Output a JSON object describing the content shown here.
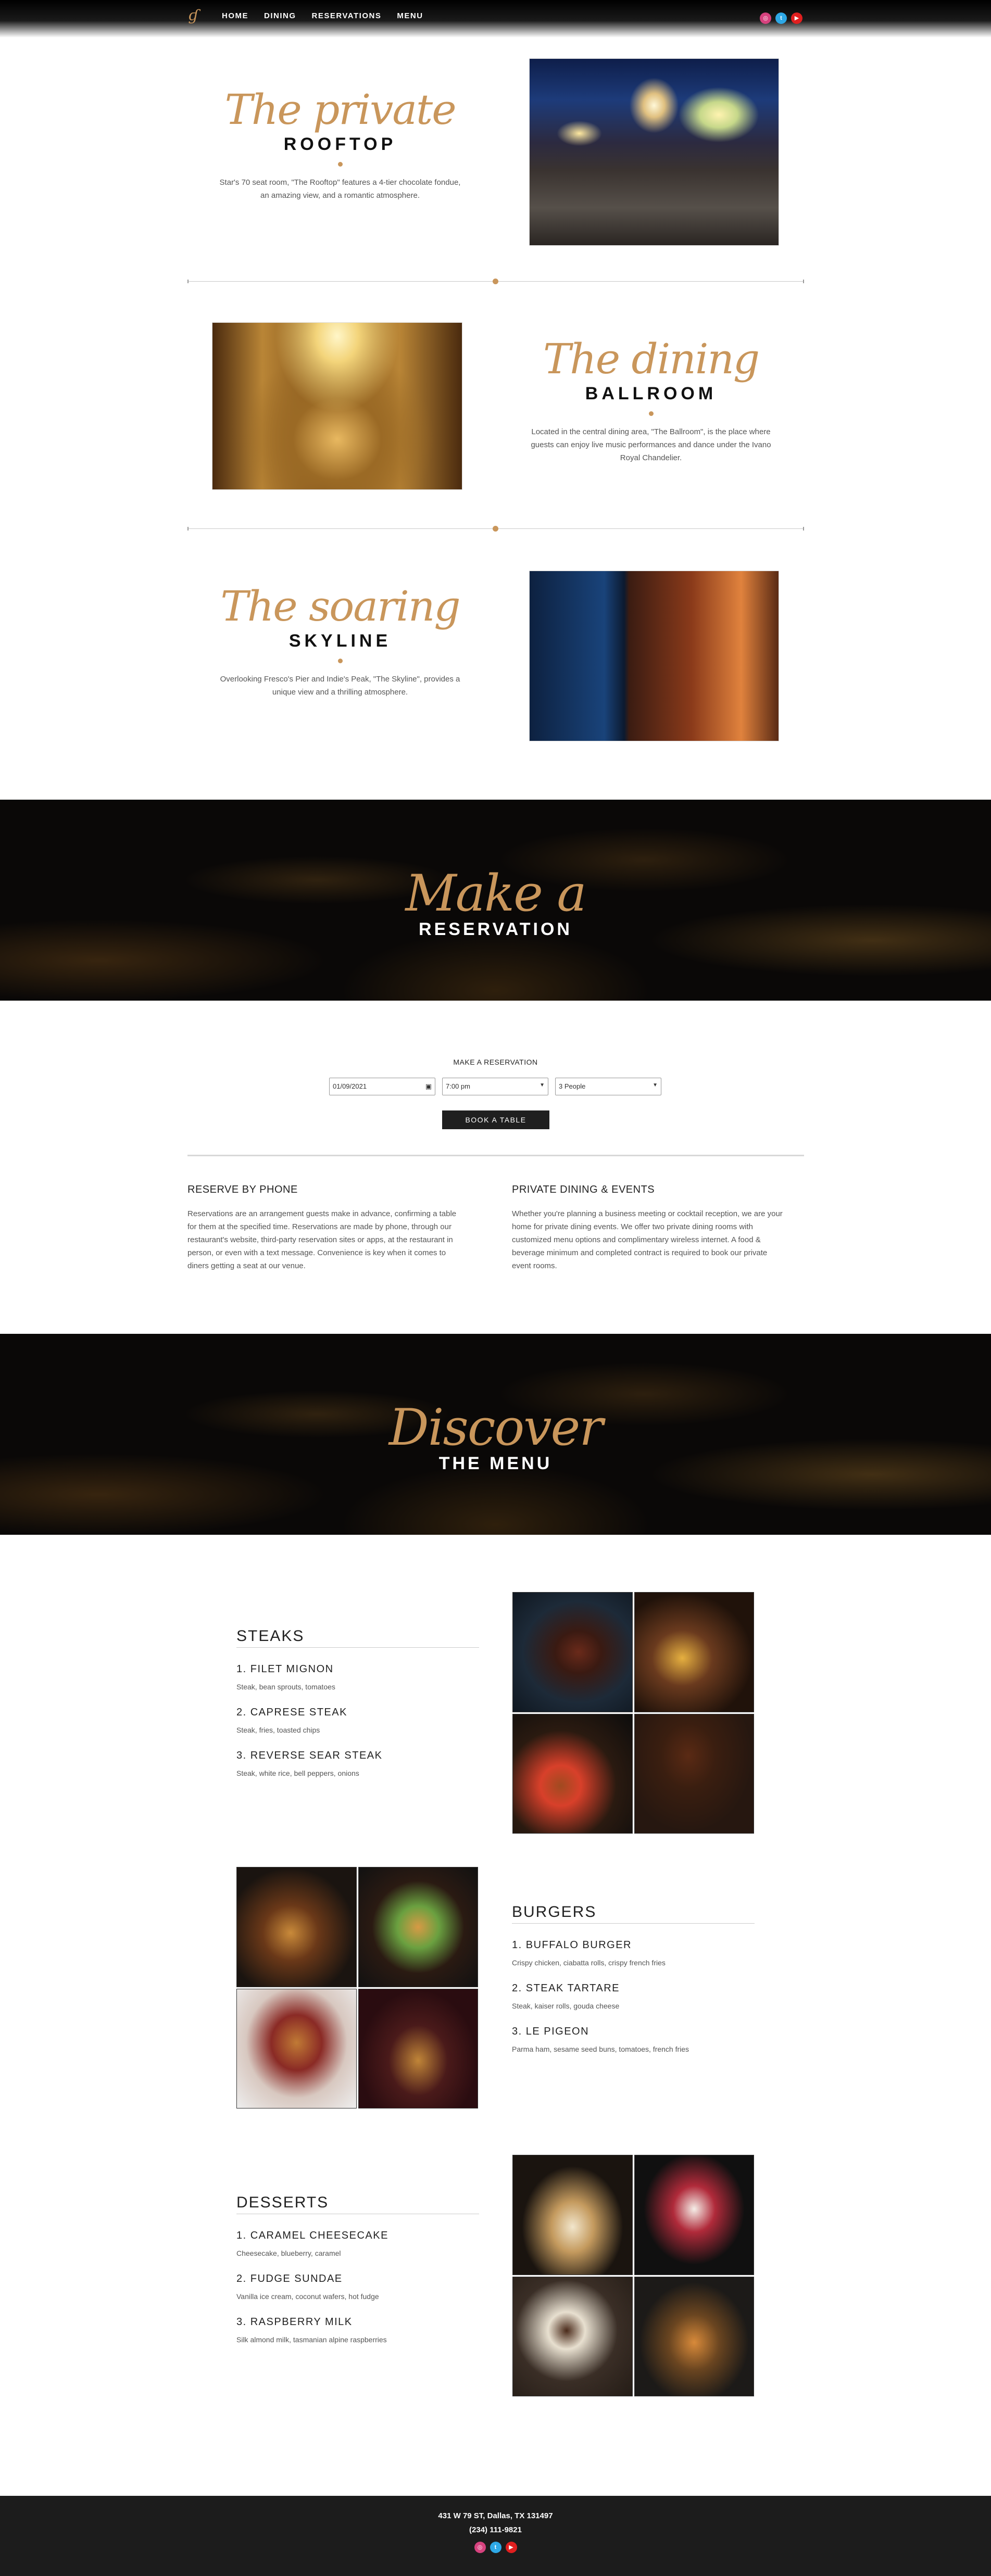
{
  "nav": {
    "items": [
      "HOME",
      "DINING",
      "RESERVATIONS",
      "MENU"
    ]
  },
  "social": {
    "instagram": "instagram-icon",
    "twitter": "twitter-icon",
    "youtube": "youtube-icon"
  },
  "colors": {
    "accent": "#c9965b",
    "dark": "#0a0807",
    "button": "#1f1f1f"
  },
  "venues": [
    {
      "script": "The private",
      "title": "ROOFTOP",
      "description": "Star's 70 seat room, \"The Rooftop\" features a 4-tier chocolate fondue, an amazing view, and a romantic atmosphere."
    },
    {
      "script": "The dining",
      "title": "BALLROOM",
      "description": "Located in the central dining area, \"The Ballroom\", is the place where guests can enjoy live music performances and dance under the Ivano Royal Chandelier."
    },
    {
      "script": "The soaring",
      "title": "SKYLINE",
      "description": "Overlooking Fresco's Pier and Indie's Peak, \"The Skyline\", provides a unique view and a thrilling atmosphere."
    }
  ],
  "reservation_banner": {
    "script": "Make a",
    "title": "RESERVATION"
  },
  "form": {
    "title": "MAKE A RESERVATION",
    "date": "01/09/2021",
    "time": "7:00 pm",
    "party": "3 People",
    "button": "BOOK A TABLE"
  },
  "info": [
    {
      "title": "RESERVE BY PHONE",
      "text": "Reservations are an arrangement guests make in advance, confirming a table for them at the specified time. Reservations are made by phone, through our restaurant's website, third-party reservation sites or apps, at the restaurant in person, or even with a text message. Convenience is key when it comes to diners getting a seat at our venue."
    },
    {
      "title": "PRIVATE DINING & EVENTS",
      "text": "Whether you're planning a business meeting or cocktail reception, we are your home for private dining events. We offer two private dining rooms with customized menu options and complimentary wireless internet. A food & beverage minimum and completed contract is required to book our private event rooms."
    }
  ],
  "menu_banner": {
    "script": "Discover",
    "title": "THE MENU"
  },
  "menu": [
    {
      "category": "STEAKS",
      "items": [
        {
          "name": "1. FILET MIGNON",
          "desc": "Steak, bean sprouts, tomatoes"
        },
        {
          "name": "2. CAPRESE STEAK",
          "desc": "Steak, fries, toasted chips"
        },
        {
          "name": "3. REVERSE SEAR STEAK",
          "desc": "Steak, white rice, bell peppers, onions"
        }
      ]
    },
    {
      "category": "BURGERS",
      "items": [
        {
          "name": "1. BUFFALO BURGER",
          "desc": "Crispy chicken, ciabatta rolls, crispy french fries"
        },
        {
          "name": "2. STEAK TARTARE",
          "desc": "Steak, kaiser rolls, gouda cheese"
        },
        {
          "name": "3. LE PIGEON",
          "desc": "Parma ham, sesame seed buns, tomatoes, french fries"
        }
      ]
    },
    {
      "category": "DESSERTS",
      "items": [
        {
          "name": "1. CARAMEL CHEESECAKE",
          "desc": "Cheesecake, blueberry, caramel"
        },
        {
          "name": "2. FUDGE SUNDAE",
          "desc": "Vanilla ice cream, coconut wafers, hot fudge"
        },
        {
          "name": "3. RASPBERRY MILK",
          "desc": "Silk almond milk, tasmanian alpine raspberries"
        }
      ]
    }
  ],
  "footer": {
    "address": "431 W 79 ST, Dallas, TX 131497",
    "phone": "(234) 111-9821"
  }
}
